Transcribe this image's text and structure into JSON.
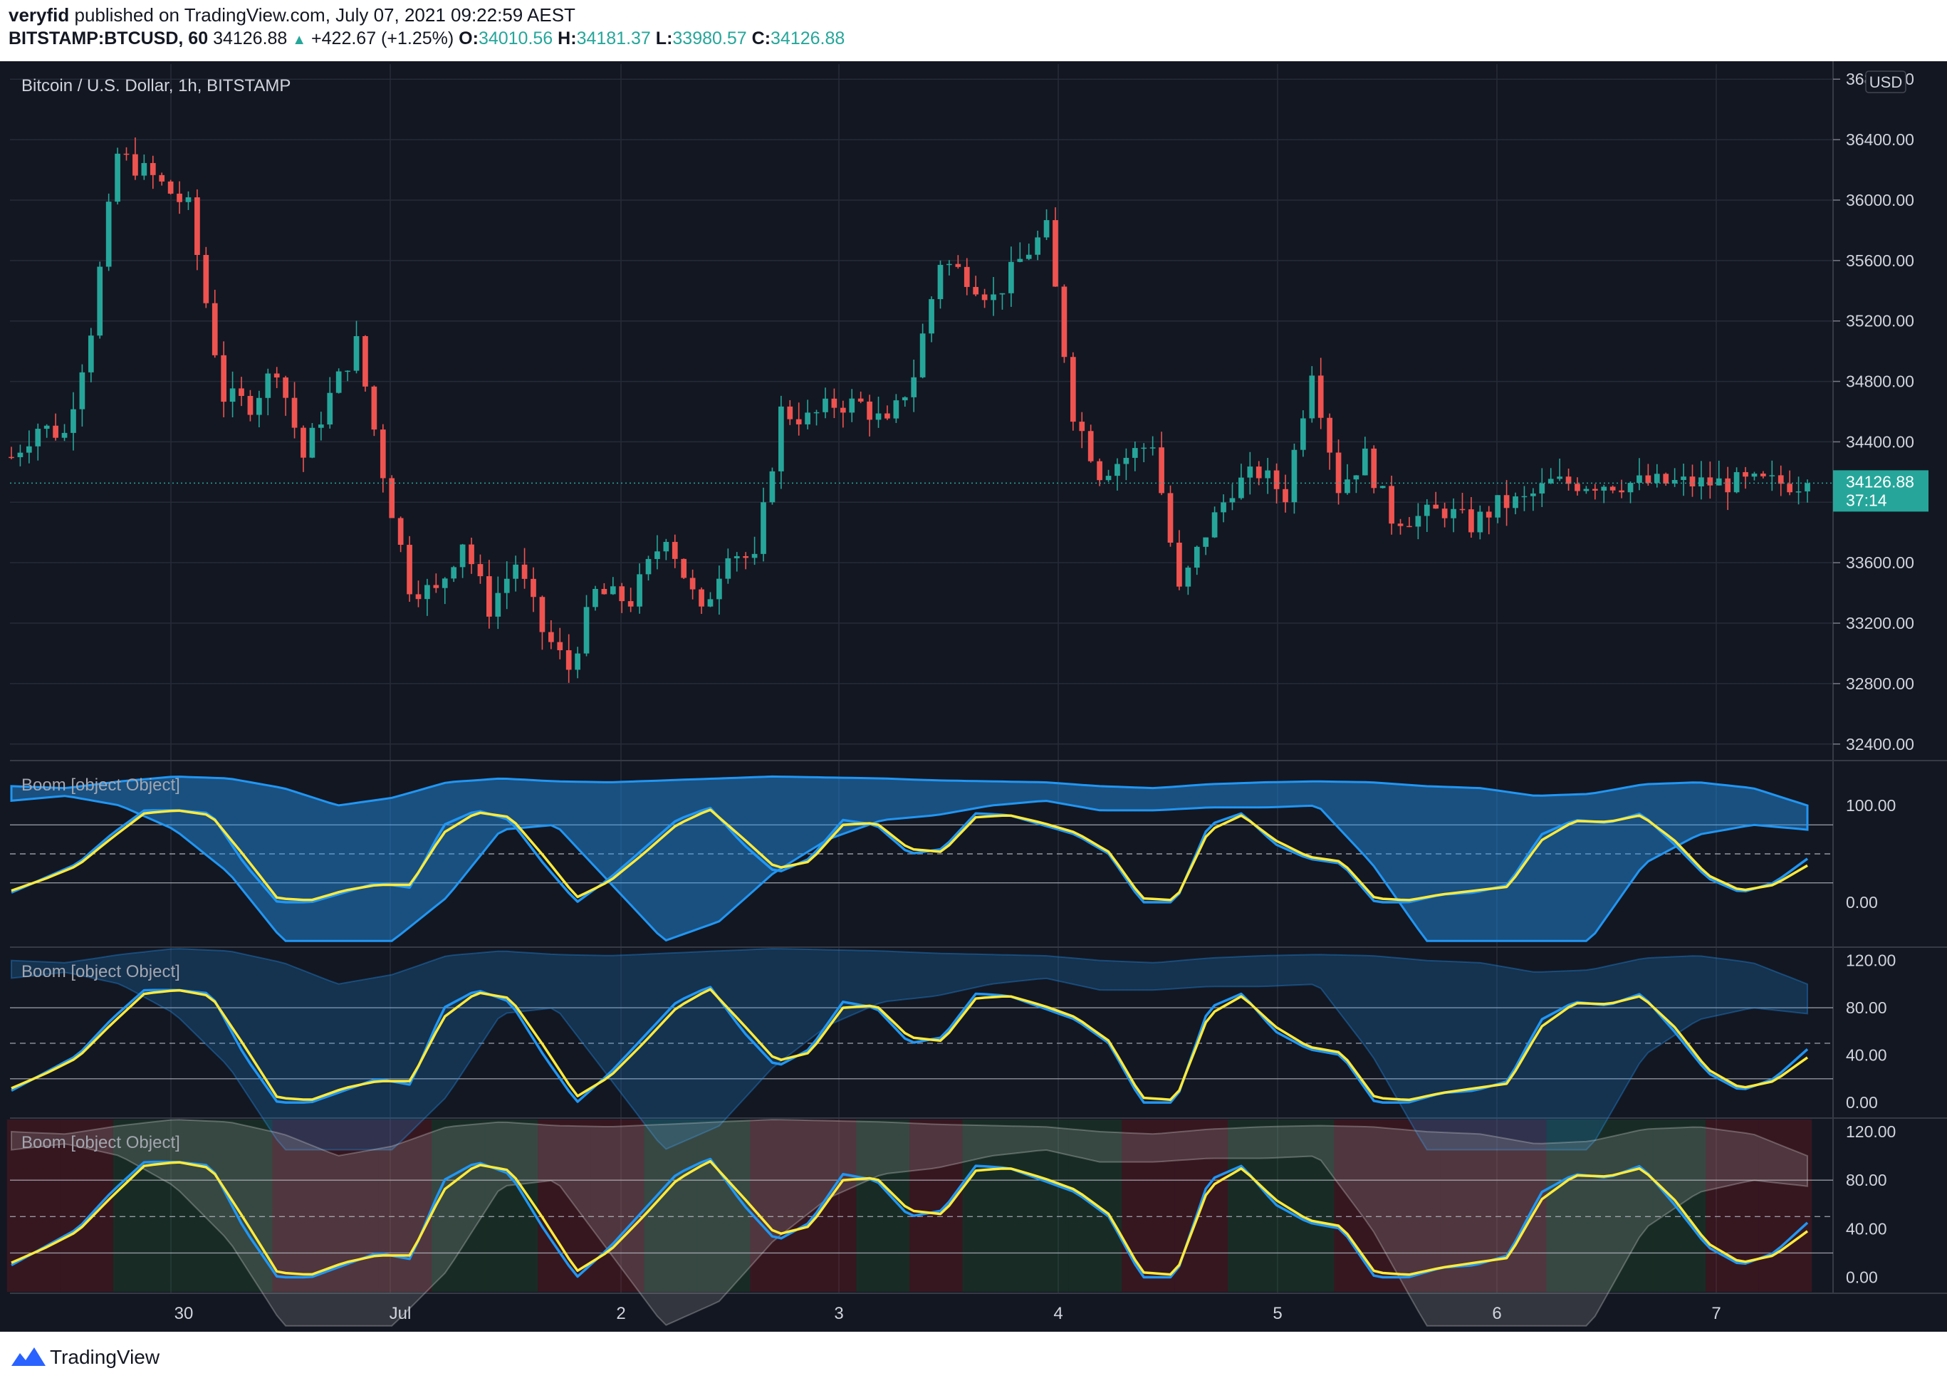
{
  "header": {
    "publisher": "veryfid",
    "published_text": "published on TradingView.com, July 07, 2021 09:22:59 AEST",
    "symbol": "BITSTAMP:BTCUSD, 60",
    "last": "34126.88",
    "change": "+422.67 (+1.25%)",
    "o_label": "O:",
    "o_value": "34010.56",
    "h_label": "H:",
    "h_value": "34181.37",
    "l_label": "L:",
    "l_value": "33980.57",
    "c_label": "C:",
    "c_value": "34126.88"
  },
  "footer": {
    "brand": "TradingView"
  },
  "colors": {
    "background": "#131722",
    "up": "#26a69a",
    "down": "#ef5350",
    "blue": "#2196f3",
    "yellow": "#ffeb3b",
    "grid": "#262b38",
    "axis_text": "#d1d4dc"
  },
  "chart_data": {
    "type": "candlestick",
    "title": "Bitcoin / U.S. Dollar, 1h, BITSTAMP",
    "currency": "USD",
    "price_ylim": [
      32300,
      36900
    ],
    "price_ticks": [
      "36800.00",
      "36400.00",
      "36000.00",
      "35600.00",
      "35200.00",
      "34800.00",
      "34400.00",
      "34000.00",
      "33600.00",
      "33200.00",
      "32800.00",
      "32400.00"
    ],
    "price_tick_values": [
      36800,
      36400,
      36000,
      35600,
      35200,
      34800,
      34400,
      34000,
      33600,
      33200,
      32800,
      32400
    ],
    "last_price_label": "34126.88",
    "countdown_label": "37:14",
    "x_ticks": [
      "30",
      "Jul",
      "2",
      "3",
      "4",
      "5",
      "6",
      "7"
    ],
    "close_anchors_hours": [
      0,
      3,
      6,
      9,
      12,
      16,
      20,
      24,
      27,
      30,
      33,
      36,
      39,
      42,
      45,
      48,
      51,
      54,
      57,
      60,
      63,
      66,
      70,
      74,
      78,
      81,
      84,
      87,
      90,
      93,
      96,
      99,
      102,
      105,
      108,
      111,
      114,
      117,
      120,
      123,
      126,
      129,
      132,
      135,
      138,
      141,
      144,
      147,
      150,
      153,
      156,
      159,
      162,
      165,
      168,
      171,
      174,
      177,
      180,
      183,
      186,
      189,
      192,
      195,
      198,
      201,
      203
    ],
    "close_anchor_values": [
      34300,
      34500,
      34450,
      35150,
      36300,
      36150,
      35950,
      34700,
      34650,
      34900,
      34300,
      34700,
      35050,
      34200,
      33450,
      33400,
      33750,
      33300,
      33600,
      33150,
      32900,
      33400,
      33350,
      33800,
      33250,
      33700,
      33600,
      34600,
      34550,
      34650,
      34650,
      34500,
      34850,
      35600,
      35500,
      35350,
      35600,
      35800,
      34600,
      34200,
      34300,
      34400,
      33400,
      33800,
      34100,
      34200,
      34050,
      34900,
      34100,
      34300,
      33900,
      33900,
      33950,
      33850,
      33980,
      34010,
      34127,
      34127,
      34127,
      34127,
      34127,
      34127,
      34127,
      34127,
      34127,
      34127,
      34127
    ],
    "indicators": [
      {
        "label": "Boom [object Object]",
        "ticks": [
          "100.00",
          "0.00"
        ],
        "tick_values": [
          100,
          0
        ],
        "ylim": [
          -45,
          145
        ],
        "levels": [
          80,
          50,
          20
        ],
        "fast_anchors": [
          10,
          25,
          40,
          70,
          95,
          95,
          92,
          40,
          0,
          0,
          10,
          20,
          15,
          80,
          95,
          85,
          40,
          0,
          25,
          55,
          85,
          98,
          60,
          30,
          45,
          85,
          80,
          50,
          55,
          92,
          90,
          80,
          70,
          50,
          0,
          0,
          80,
          92,
          60,
          45,
          40,
          0,
          0,
          8,
          10,
          18,
          70,
          85,
          82,
          92,
          60,
          25,
          10,
          20,
          45
        ],
        "slow_anchors": [
          12,
          24,
          38,
          66,
          92,
          95,
          90,
          48,
          4,
          2,
          12,
          18,
          18,
          72,
          93,
          88,
          48,
          5,
          22,
          50,
          80,
          96,
          66,
          35,
          42,
          80,
          82,
          55,
          52,
          88,
          90,
          82,
          72,
          52,
          4,
          2,
          74,
          90,
          64,
          47,
          42,
          4,
          2,
          8,
          12,
          16,
          64,
          84,
          83,
          90,
          64,
          28,
          12,
          18,
          38
        ],
        "band_upper_anchors": [
          120,
          118,
          125,
          130,
          128,
          118,
          100,
          108,
          124,
          128,
          125,
          124,
          126,
          128,
          130,
          129,
          128,
          126,
          125,
          124,
          120,
          118,
          122,
          124,
          125,
          124,
          120,
          118,
          110,
          112,
          122,
          124,
          118,
          100
        ],
        "band_lower_anchors": [
          105,
          110,
          100,
          75,
          30,
          -40,
          -40,
          -40,
          5,
          75,
          80,
          20,
          -40,
          -20,
          30,
          65,
          85,
          90,
          100,
          105,
          95,
          95,
          98,
          98,
          100,
          40,
          -40,
          -40,
          -40,
          -40,
          40,
          70,
          80,
          75
        ]
      },
      {
        "label": "Boom [object Object]",
        "ticks": [
          "120.00",
          "80.00",
          "40.00",
          "0.00"
        ],
        "tick_values": [
          120,
          80,
          40,
          0
        ]
      },
      {
        "label": "Boom [object Object]",
        "ticks": [
          "120.00",
          "80.00",
          "40.00",
          "0.00"
        ],
        "tick_values": [
          120,
          80,
          40,
          0
        ]
      }
    ]
  }
}
